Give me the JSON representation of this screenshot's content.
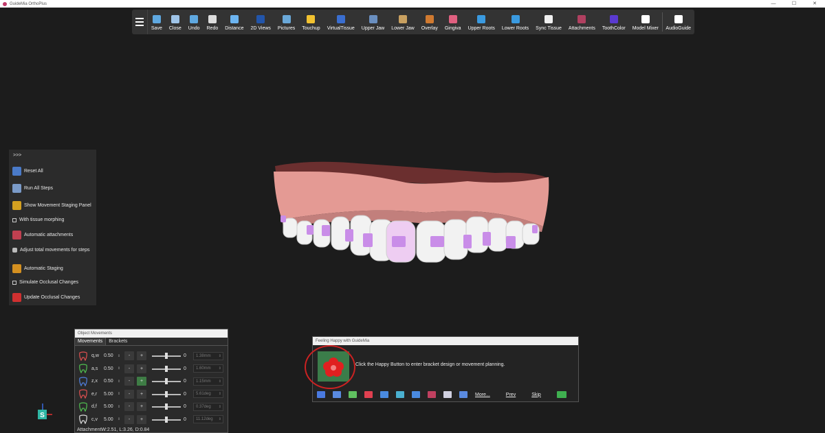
{
  "app": {
    "title": "GuideMia OrthoPlus"
  },
  "window_controls": [
    "—",
    "☐",
    "✕"
  ],
  "toolbar": {
    "items": [
      {
        "label": "Save",
        "icon": "save-icon",
        "color": "#5fa8e0"
      },
      {
        "label": "Close",
        "icon": "close-icon",
        "color": "#9fc4e8"
      },
      {
        "label": "Undo",
        "icon": "undo-icon",
        "color": "#5fa8e0"
      },
      {
        "label": "Redo",
        "icon": "redo-icon",
        "color": "#dddddd"
      },
      {
        "label": "Distance",
        "icon": "ruler-icon",
        "color": "#6cb4f0"
      },
      {
        "label": "2D Views",
        "icon": "views-2d-icon",
        "color": "#2255aa"
      },
      {
        "label": "Pictures",
        "icon": "pictures-icon",
        "color": "#6aa8d8"
      },
      {
        "label": "Touchup",
        "icon": "touchup-icon",
        "color": "#f2c230"
      },
      {
        "label": "VirtualTissue",
        "icon": "virtual-tissue-icon",
        "color": "#3a6ed0"
      },
      {
        "label": "Upper Jaw",
        "icon": "upper-jaw-icon",
        "color": "#6a8fc0"
      },
      {
        "label": "Lower Jaw",
        "icon": "lower-jaw-icon",
        "color": "#c8a060"
      },
      {
        "label": "Overlay",
        "icon": "overlay-icon",
        "color": "#d07a30"
      },
      {
        "label": "Gingiva",
        "icon": "gingiva-icon",
        "color": "#e06080"
      },
      {
        "label": "Upper Roots",
        "icon": "upper-roots-icon",
        "color": "#3a9ae0"
      },
      {
        "label": "Lower Roots",
        "icon": "lower-roots-icon",
        "color": "#3a9ae0"
      },
      {
        "label": "Sync Tissue",
        "icon": "sync-tissue-icon",
        "color": "#f0f0f0"
      },
      {
        "label": "Attachments",
        "icon": "attachments-icon",
        "color": "#b04060"
      },
      {
        "label": "ToothColor",
        "icon": "tooth-color-icon",
        "color": "#5a3ad0"
      },
      {
        "label": "Model Mixer",
        "icon": "model-mixer-icon",
        "color": "#ffffff"
      },
      {
        "label": "AudioGuide",
        "icon": "audio-guide-icon",
        "color": "#ffffff"
      }
    ]
  },
  "side_panel": {
    "expand_label": ">>>",
    "items": [
      {
        "label": "Reset All",
        "icon": "reset-icon",
        "color": "#4a7ac8",
        "type": "icon"
      },
      {
        "label": "Run All Steps",
        "icon": "run-steps-icon",
        "color": "#7a9ac8",
        "type": "icon"
      },
      {
        "label": "Show Movement Staging Panel",
        "icon": "staging-panel-icon",
        "color": "#d4a020",
        "type": "icon"
      },
      {
        "label": "With tissue morphing",
        "type": "check"
      },
      {
        "label": "Automatic attachments",
        "icon": "auto-attachments-icon",
        "color": "#c04050",
        "type": "icon"
      },
      {
        "label": "Adjust total movements for steps",
        "icon": "adjust-movements-icon",
        "color": "#bbbbbb",
        "type": "small"
      },
      {
        "label": "Automatic Staging",
        "icon": "auto-staging-icon",
        "color": "#d49020",
        "type": "icon"
      },
      {
        "label": "Simulate Occlusal Changes",
        "type": "check"
      },
      {
        "label": "Update Occlusal Changes",
        "icon": "update-occlusal-icon",
        "color": "#d03030",
        "type": "icon"
      }
    ]
  },
  "object_movements": {
    "title": "Object Movements",
    "tabs": [
      "Movements",
      "Brackets"
    ],
    "minus_label": "-",
    "plus_label": "+",
    "spin_glyph": "⇕",
    "rows": [
      {
        "axis": "q,w",
        "step": "0.50",
        "slider": "0",
        "measure": "1.38mm",
        "icon": "tooth-rotate-icon",
        "color": "#e05050",
        "plus_active": false
      },
      {
        "axis": "a,s",
        "step": "0.50",
        "slider": "0",
        "measure": "1.60mm",
        "icon": "tooth-mesial-icon",
        "color": "#50c050",
        "plus_active": false
      },
      {
        "axis": "z,x",
        "step": "0.50",
        "slider": "0",
        "measure": "1.15mm",
        "icon": "tooth-intrude-icon",
        "color": "#5080e0",
        "plus_active": true
      },
      {
        "axis": "e,r",
        "step": "5.00",
        "slider": "0",
        "measure": "5.61deg",
        "icon": "tooth-tip-icon",
        "color": "#e05050",
        "plus_active": false
      },
      {
        "axis": "d,f",
        "step": "5.00",
        "slider": "0",
        "measure": "0.37deg",
        "icon": "tooth-torque-icon",
        "color": "#50c050",
        "plus_active": false
      },
      {
        "axis": "c,v",
        "step": "5.00",
        "slider": "0",
        "measure": "11.12deg",
        "icon": "tooth-arch-icon",
        "color": "#dddddd",
        "plus_active": false
      }
    ],
    "footer": "AttachmentW:2.51, L:3.26, D:0.84"
  },
  "happy_panel": {
    "title": "Feeling Happy with GuideMia",
    "message": "Click the Happy Button to enter bracket design or movement planning.",
    "icons": [
      {
        "name": "menu-lines-icon",
        "color": "#4a7ae0"
      },
      {
        "name": "bracket-plate-icon",
        "color": "#5a8ae0"
      },
      {
        "name": "tools-icon",
        "color": "#60c060"
      },
      {
        "name": "wire-icon",
        "color": "#e04050"
      },
      {
        "name": "tooth-outline-icon",
        "color": "#4a8ae0"
      },
      {
        "name": "tooth-search-icon",
        "color": "#4ab0d0"
      },
      {
        "name": "monitor-icon",
        "color": "#4a8ae0"
      },
      {
        "name": "attachment-icon",
        "color": "#c04060"
      },
      {
        "name": "bank-icon",
        "color": "#d0d0e0"
      },
      {
        "name": "blocks-icon",
        "color": "#5a8ae0"
      }
    ],
    "more_label": "More...",
    "prev_label": "Prev",
    "skip_label": "Skip"
  },
  "gizmo": {
    "label": "S"
  }
}
